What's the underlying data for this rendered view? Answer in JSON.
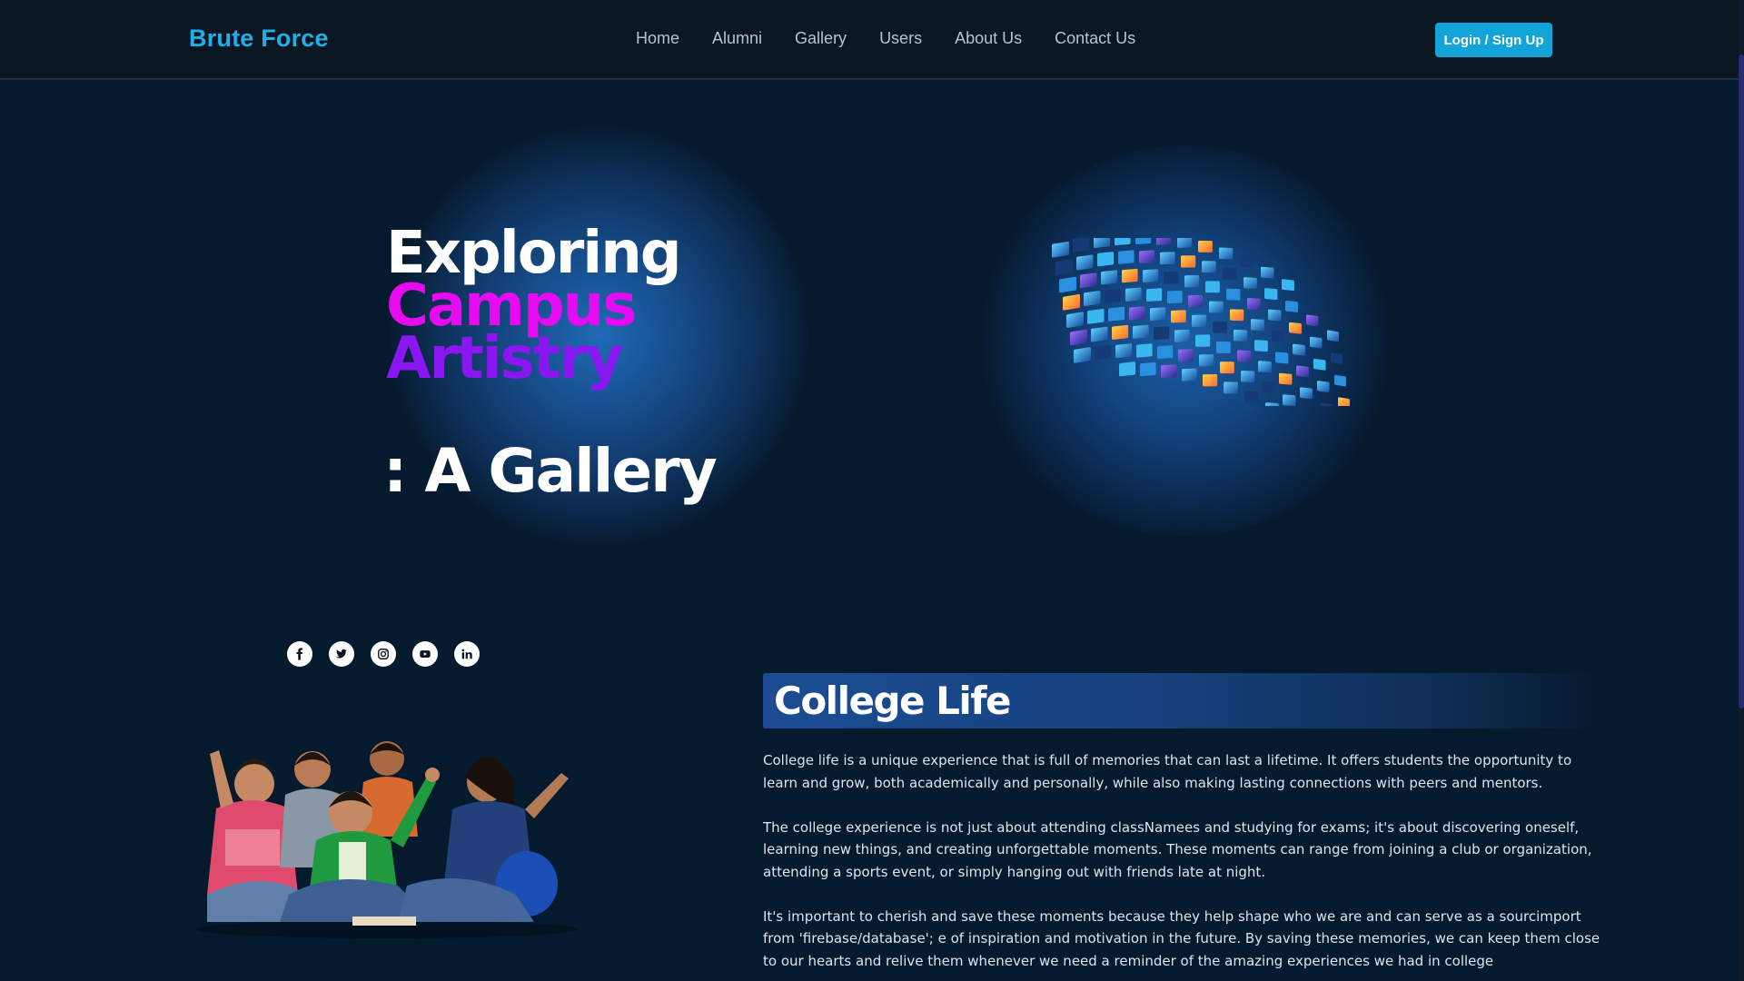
{
  "header": {
    "brand": "Brute Force",
    "nav": [
      "Home",
      "Alumni",
      "Gallery",
      "Users",
      "About Us",
      "Contact Us"
    ],
    "login_label": "Login / Sign Up"
  },
  "hero": {
    "line1": "Exploring",
    "line2": "Campus",
    "line3": "Artistry",
    "subtitle": ": A Gallery",
    "line2_color": "#e60bf0",
    "line3_color": "#8a16f2"
  },
  "social": {
    "icons": [
      "facebook-icon",
      "twitter-icon",
      "instagram-icon",
      "youtube-icon",
      "linkedin-icon"
    ]
  },
  "college": {
    "title": "College Life",
    "paragraphs": [
      "College life is a unique experience that is full of memories that can last a lifetime. It offers students the opportunity to learn and grow, both academically and personally, while also making lasting connections with peers and mentors.",
      "The college experience is not just about attending classNamees and studying for exams; it's about discovering oneself, learning new things, and creating unforgettable moments. These moments can range from joining a club or organization, attending a sports event, or simply hanging out with friends late at night.",
      "It's important to cherish and save these moments because they help shape who we are and can serve as a sourcimport from 'firebase/database'; e of inspiration and motivation in the future. By saving these memories, we can keep them close to our hearts and relive them whenever we need a reminder of the amazing experiences we had in college"
    ]
  },
  "colors": {
    "background": "#061a2e",
    "header": "#0a1622",
    "brand": "#1fb0e6",
    "button": "#12a4d9"
  }
}
